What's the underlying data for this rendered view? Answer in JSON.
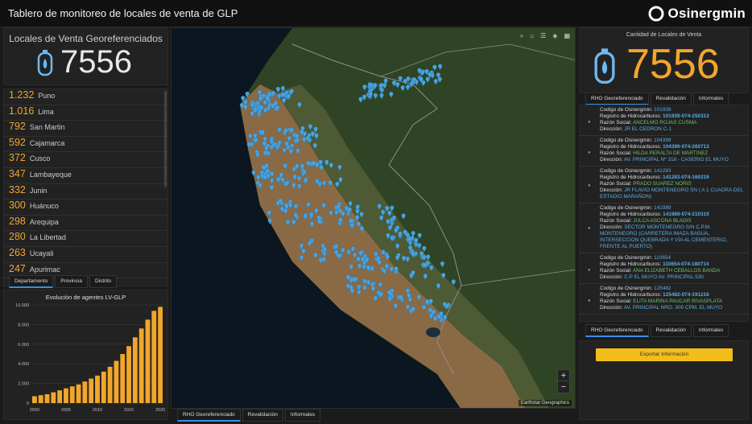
{
  "header": {
    "title": "Tablero de monitoreo de locales de venta de GLP",
    "logo_text": "Osinergmin"
  },
  "left_counter": {
    "title": "Locales de Venta Georeferenciados",
    "value": "7556",
    "icon": "gas-cylinder-icon"
  },
  "ranking": [
    {
      "value": "1.232",
      "name": "Puno"
    },
    {
      "value": "1.016",
      "name": "Lima"
    },
    {
      "value": "792",
      "name": "San Martin"
    },
    {
      "value": "592",
      "name": "Cajamarca"
    },
    {
      "value": "372",
      "name": "Cusco"
    },
    {
      "value": "347",
      "name": "Lambayeque"
    },
    {
      "value": "332",
      "name": "Junin"
    },
    {
      "value": "300",
      "name": "Huánuco"
    },
    {
      "value": "298",
      "name": "Arequipa"
    },
    {
      "value": "280",
      "name": "La Libertad"
    },
    {
      "value": "263",
      "name": "Ucayali"
    },
    {
      "value": "247",
      "name": "Apurimac"
    }
  ],
  "ranking_tabs": [
    "Departamento",
    "Provincia",
    "Distrito"
  ],
  "chart_data": {
    "type": "bar",
    "title": "Evolución de agentes LV-GLP",
    "x": [
      2000,
      2001,
      2002,
      2003,
      2004,
      2005,
      2006,
      2007,
      2008,
      2009,
      2010,
      2011,
      2012,
      2013,
      2014,
      2015,
      2016,
      2017,
      2018,
      2019,
      2020
    ],
    "values": [
      700,
      800,
      900,
      1100,
      1300,
      1500,
      1700,
      1900,
      2200,
      2500,
      2800,
      3200,
      3700,
      4300,
      5000,
      5800,
      6700,
      7600,
      8500,
      9400,
      9800
    ],
    "ylim": [
      0,
      10000
    ],
    "yticks": [
      "0",
      "2.000",
      "4.000",
      "6.000",
      "8.000",
      "10.000"
    ],
    "xticks": [
      "2000",
      "2005",
      "2010",
      "2015",
      "2020"
    ],
    "bar_color": "#f2a62b",
    "grid": true
  },
  "map": {
    "tools": [
      "search-icon",
      "home-icon",
      "list-icon",
      "layers-icon",
      "basemap-icon"
    ],
    "zoom_in": "+",
    "zoom_out": "−",
    "attribution": "Earthstar Geographics",
    "marker_color": "#4aa3e0"
  },
  "map_tabs": [
    "RHO Georeferenciado",
    "Revalidación",
    "Informales"
  ],
  "right_counter": {
    "title": "Cantidad de Locales de Venta",
    "value": "7556",
    "icon": "gas-cylinder-icon"
  },
  "right_tabs": [
    "RHO Georeferenciado",
    "Revalidación",
    "Informales"
  ],
  "records": [
    {
      "code": "101939",
      "reg": "101939-074-250313",
      "name": "ANCELMO ROJAS CUSMA",
      "addr": "JR EL CEDRON C-1"
    },
    {
      "code": "104399",
      "reg": "104399-074-260713",
      "name": "HILDA PERALTA DE MARTINEZ",
      "addr": "AV. PRINCIPAL Nº 318 - CASERIO EL MUYO"
    },
    {
      "code": "141283",
      "reg": "141283-074-160219",
      "name": "PRADO SUAREZ NORIS",
      "addr": "JR FLAVIO MONTENEGRO SN ( A 1 CUADRA DEL ESTADIO MARAÑON)"
    },
    {
      "code": "141989",
      "reg": "141989-074-210319",
      "name": "JULCA ASCONA BLADIS",
      "addr": "SECTOR MONTENEGRO S/N C.P.M. MONTENEGRO (CARRETERA IMAZA BAGUA, INTERSECCION QUEBRADA Y VÍA AL CEMENTERIO, FRENTE AL PUERTO)"
    },
    {
      "code": "110654",
      "reg": "110654-074-180714",
      "name": "ANA ELIZABETH CEBALLOS BANDA",
      "addr": "C.P EL MUYO AV. PRINCIPAL 530"
    },
    {
      "code": "125482",
      "reg": "125482-074-191216",
      "name": "ELITA MARINA PAUCAR RIVASPLATA",
      "addr": "AV. PRINCIPAL NRO. 309 CPM. EL MUYO"
    }
  ],
  "record_labels": {
    "code": "Codigo de Osinergmin:",
    "reg": "Registro de Hidrocarburos:",
    "name": "Razón Social:",
    "addr": "Dirección:"
  },
  "bottom_right_tabs": [
    "RHO Georeferenciado",
    "Revalidación",
    "Informales"
  ],
  "export_label": "Exportar Información"
}
